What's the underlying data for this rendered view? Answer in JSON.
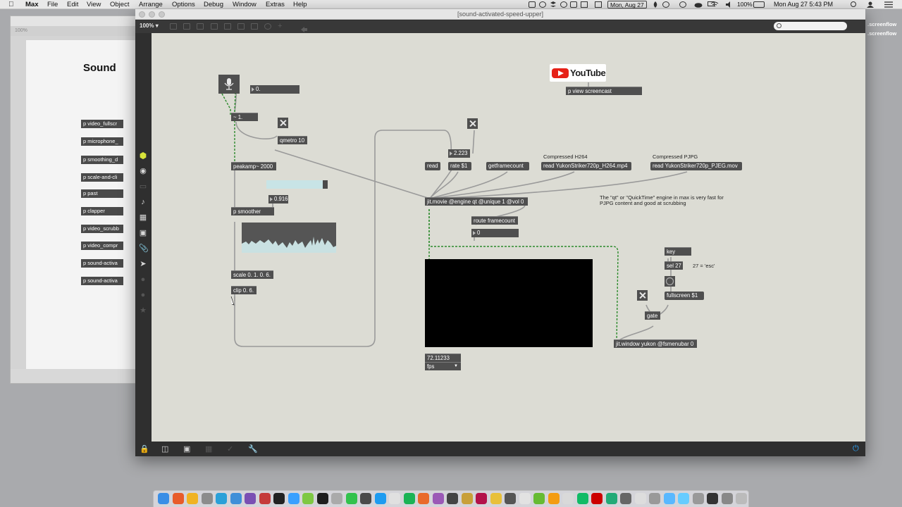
{
  "menubar": {
    "apple": "",
    "items": [
      "Max",
      "File",
      "Edit",
      "View",
      "Object",
      "Arrange",
      "Options",
      "Debug",
      "Window",
      "Extras",
      "Help"
    ],
    "date_box": "Mon, Aug 27",
    "battery": "100%",
    "clock": "Mon Aug 27  5:43 PM"
  },
  "desktop": {
    "file_labels": [
      ".screenflow",
      ".screenflow"
    ]
  },
  "background_window": {
    "title_partial": "Sound",
    "zoom": "100%",
    "objects": [
      "p video_fullscr",
      "p microphone_",
      "p smoothing_d",
      "p scale-and-cli",
      "p past",
      "p clapper",
      "p video_scrubb",
      "p video_compr",
      "p sound-activa",
      "p sound-activa"
    ]
  },
  "window": {
    "title": "[sound-activated-speed-upper]",
    "zoom": "100%",
    "zoom_arrow": "▾"
  },
  "patch": {
    "youtube_label": "YouTube",
    "view_screencast": "p view screencast",
    "mic_number": "0.",
    "adc": "~ 1.",
    "qmetro": "qmetro 10",
    "peakamp": "peakamp~ 2000",
    "smoother_value": "0.916",
    "smoother": "p smoother",
    "scale": "scale 0. 1. 0. 6.",
    "clip": "clip 0. 6.",
    "rate_number": "2.223",
    "read": "read",
    "rate_msg": "rate $1",
    "getframecount": "getframecount",
    "comment_h264": "Compressed H264",
    "read_h264": "read YukonStriker720p_H264.mp4",
    "comment_pjpg": "Compressed PJPG",
    "read_pjpeg": "read YukonStriker720p_PJEG.mov",
    "jit_movie": "jit.movie @engine qt @unique 1 @vol 0",
    "route_framecount": "route framecount",
    "framecount_number": "0",
    "qt_note_line1": "The \"qt\" or \"QuickTime\" engine in max is very fast for",
    "qt_note_line2": "PJPG content and good at scrubbing",
    "fps_value": "72.11233",
    "fps_label": "fps",
    "key": "key",
    "sel": "sel 27",
    "esc_note": "27 = 'esc'",
    "fullscreen": "fullscreen $1",
    "gate": "gate",
    "jit_window": "jit.window yukon @fsmenubar 0"
  }
}
